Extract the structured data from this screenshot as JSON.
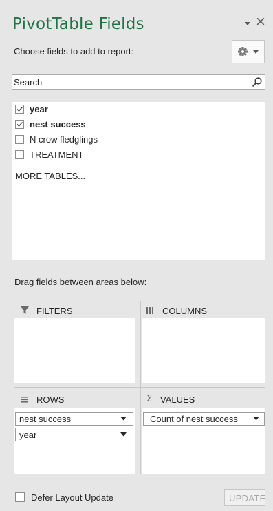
{
  "header": {
    "title": "PivotTable Fields",
    "close_glyph": "×"
  },
  "toolbar": {
    "choose_label": "Choose fields to add to report:"
  },
  "search": {
    "placeholder": "Search",
    "value": ""
  },
  "fields": [
    {
      "label": "year",
      "checked": true
    },
    {
      "label": "nest success",
      "checked": true
    },
    {
      "label": "N crow fledglings",
      "checked": false
    },
    {
      "label": "TREATMENT",
      "checked": false
    }
  ],
  "more_tables": "MORE TABLES...",
  "areas": {
    "drag_label": "Drag fields between areas below:",
    "filters": {
      "label": "FILTERS",
      "icon": "filter-icon",
      "items": []
    },
    "columns": {
      "label": "COLUMNS",
      "icon": "columns-icon",
      "items": []
    },
    "rows": {
      "label": "ROWS",
      "icon": "rows-icon",
      "items": [
        "nest success",
        "year"
      ]
    },
    "values": {
      "label": "VALUES",
      "icon": "sigma-icon",
      "items": [
        "Count of nest success"
      ]
    }
  },
  "footer": {
    "defer_label": "Defer Layout Update",
    "defer_checked": false,
    "update_label": "UPDATE"
  },
  "colors": {
    "title": "#217346",
    "panel_bg": "#e6e6e6",
    "box_bg": "#ffffff",
    "disabled_text": "#a6a6a6"
  }
}
